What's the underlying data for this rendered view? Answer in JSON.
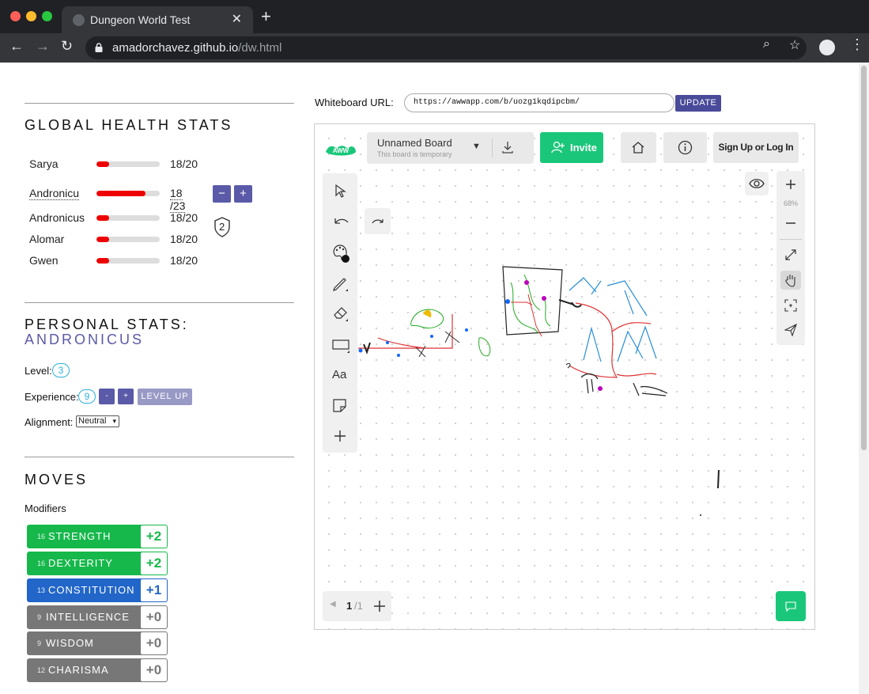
{
  "browser": {
    "tab_title": "Dungeon World Test",
    "url_host": "amadorchavez.github.io",
    "url_path": "/dw.html",
    "traffic_colors": [
      "#ff5f57",
      "#febc2e",
      "#28c840"
    ]
  },
  "health": {
    "title": "GLOBAL HEALTH STATS",
    "rows": [
      {
        "name": "Sarya",
        "hp": "18/20",
        "fraction": 0.2
      },
      {
        "name": "Andronicu",
        "hp_cur": "18",
        "hp_max": "/23",
        "fraction": 0.78
      },
      {
        "name": "Andronicus",
        "hp": "18/20",
        "fraction": 0.2
      },
      {
        "name": "Alomar",
        "hp": "18/20",
        "fraction": 0.2
      },
      {
        "name": "Gwen",
        "hp": "18/20",
        "fraction": 0.2
      }
    ],
    "armor": "2",
    "minus_label": "−",
    "plus_label": "+"
  },
  "personal": {
    "title": "PERSONAL STATS:",
    "character": "ANDRONICUS",
    "level_label": "Level:",
    "level": "3",
    "exp_label": "Experience:",
    "exp": "9",
    "minus_label": "-",
    "plus_label": "+",
    "levelup_label": "LEVEL UP",
    "alignment_label": "Alignment:",
    "alignment": "Neutral"
  },
  "moves": {
    "title": "MOVES",
    "modifiers_label": "Modifiers",
    "stats": [
      {
        "score": "16",
        "name": "STRENGTH",
        "mod": "+2",
        "color": "#16b84b"
      },
      {
        "score": "16",
        "name": "DEXTERITY",
        "mod": "+2",
        "color": "#16b84b"
      },
      {
        "score": "13",
        "name": "CONSTITUTION",
        "mod": "+1",
        "color": "#2166c8"
      },
      {
        "score": "9",
        "name": "INTELLIGENCE",
        "mod": "+0",
        "color": "#777777"
      },
      {
        "score": "9",
        "name": "WISDOM",
        "mod": "+0",
        "color": "#777777"
      },
      {
        "score": "12",
        "name": "CHARISMA",
        "mod": "+0",
        "color": "#777777"
      }
    ]
  },
  "whiteboard": {
    "label": "Whiteboard URL:",
    "url": "https://awwapp.com/b/uozg1kqdipcbm/",
    "update_label": "UPDATE",
    "board_name": "Unnamed Board",
    "board_temp": "This board is temporary",
    "invite_label": "Invite",
    "signup_label": "Sign Up or Log In",
    "text_tool": "Aa",
    "zoom": "68%",
    "page_current": "1",
    "page_total": "/1",
    "logo_text": "AWW"
  }
}
